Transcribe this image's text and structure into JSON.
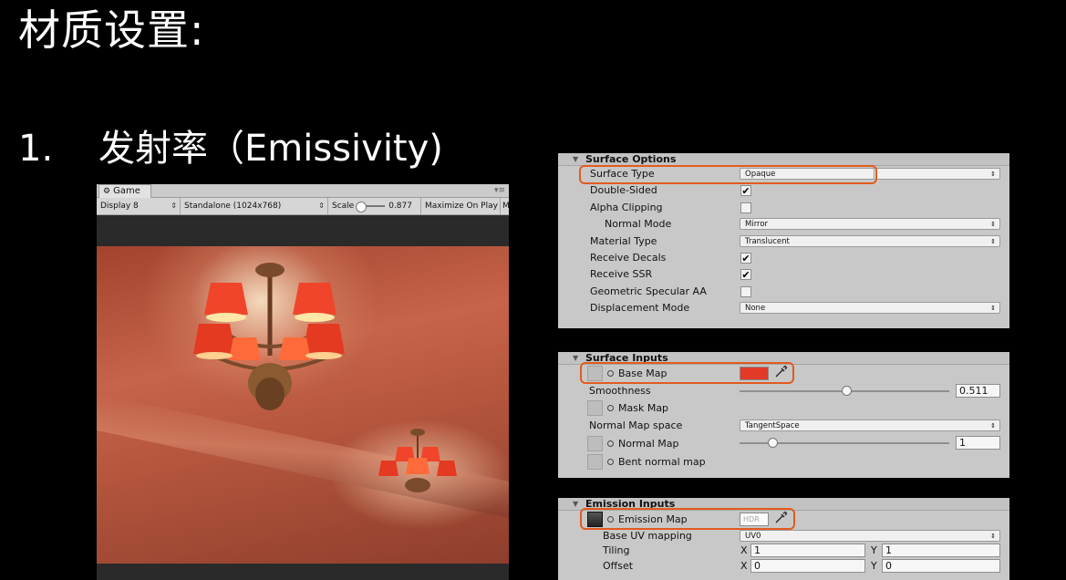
{
  "slide": {
    "title": "材质设置:",
    "section_number": "1.",
    "section_title": "发射率（Emissivity)"
  },
  "game_window": {
    "tab_label": "Game",
    "display": "Display 8",
    "resolution": "Standalone (1024x768)",
    "scale_label": "Scale",
    "scale_value": "0.877",
    "maximize": "Maximize On Play",
    "overflow": "M"
  },
  "surface_options": {
    "header": "Surface Options",
    "surface_type_label": "Surface Type",
    "surface_type_value": "Opaque",
    "double_sided_label": "Double-Sided",
    "double_sided": true,
    "alpha_clipping_label": "Alpha Clipping",
    "alpha_clipping": false,
    "normal_mode_label": "Normal Mode",
    "normal_mode_value": "Mirror",
    "material_type_label": "Material Type",
    "material_type_value": "Translucent",
    "receive_decals_label": "Receive Decals",
    "receive_decals": true,
    "receive_ssr_label": "Receive SSR",
    "receive_ssr": true,
    "geometric_aa_label": "Geometric Specular AA",
    "geometric_aa": false,
    "displacement_label": "Displacement Mode",
    "displacement_value": "None"
  },
  "surface_inputs": {
    "header": "Surface Inputs",
    "base_map_label": "Base Map",
    "base_color": "#e23a27",
    "smoothness_label": "Smoothness",
    "smoothness_value": "0.511",
    "smoothness_fraction": 0.511,
    "mask_map_label": "Mask Map",
    "normal_space_label": "Normal Map space",
    "normal_space_value": "TangentSpace",
    "normal_map_label": "Normal Map",
    "normal_map_value": "1",
    "normal_map_fraction": 0.14,
    "bent_normal_label": "Bent normal map"
  },
  "emission_inputs": {
    "header": "Emission Inputs",
    "emission_map_label": "Emission Map",
    "hdr_label": "HDR",
    "base_uv_label": "Base UV mapping",
    "base_uv_value": "UV0",
    "tiling_label": "Tiling",
    "tiling_x": "1",
    "tiling_y": "1",
    "offset_label": "Offset",
    "offset_x": "0",
    "offset_y": "0",
    "x_label": "X",
    "y_label": "Y"
  },
  "colors": {
    "highlight": "#e25b1f",
    "panel_bg": "#c8c8c8"
  }
}
